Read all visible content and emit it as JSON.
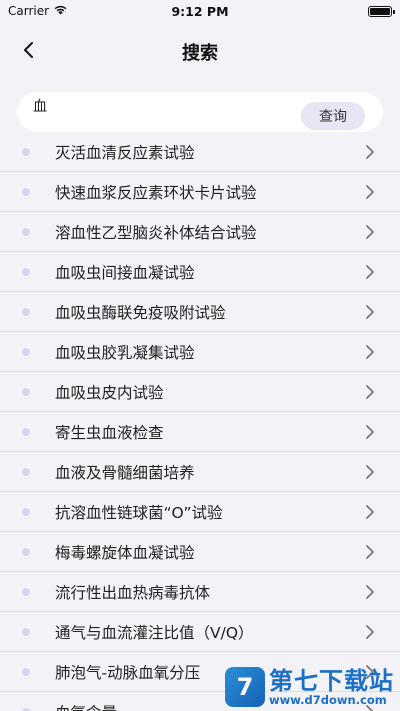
{
  "status_bar": {
    "carrier": "Carrier",
    "time": "9:12 PM",
    "battery_level": 1.0
  },
  "nav": {
    "title": "搜索"
  },
  "search": {
    "value": "血",
    "button_label": "查询"
  },
  "results": [
    "灭活血清反应素试验",
    "快速血浆反应素环状卡片试验",
    "溶血性乙型脑炎补体结合试验",
    "血吸虫间接血凝试验",
    "血吸虫酶联免疫吸附试验",
    "血吸虫胶乳凝集试验",
    "血吸虫皮内试验",
    "寄生虫血液检查",
    "血液及骨髓细菌培养",
    "抗溶血性链球菌“O”试验",
    "梅毒螺旋体血凝试验",
    "流行性出血热病毒抗体",
    "通气与血流灌注比值（V/Q）",
    "肺泡气-动脉血氧分压",
    "血氧含量"
  ],
  "watermark": {
    "logo_char": "7",
    "name": "第七下载站",
    "url": "www.d7down.com"
  },
  "colors": {
    "background": "#f2f2f7",
    "dot": "#d9d4f1",
    "button": "#e8e6f5"
  }
}
